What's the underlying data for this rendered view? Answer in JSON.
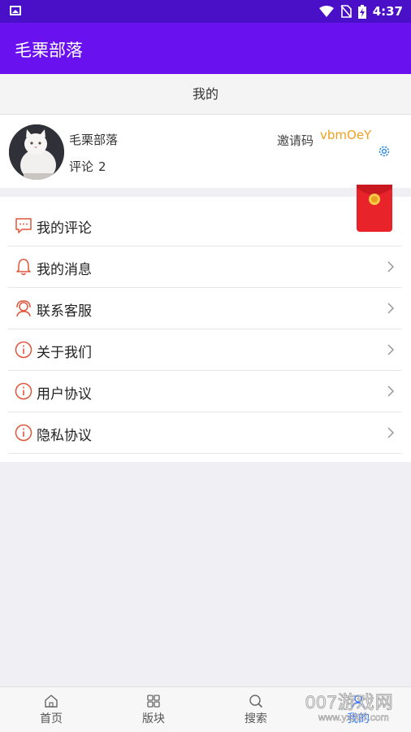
{
  "status_bar": {
    "time": "4:37"
  },
  "app_bar": {
    "title": "毛栗部落"
  },
  "page": {
    "title": "我的"
  },
  "profile": {
    "username": "毛栗部落",
    "comment_label": "评论",
    "comment_count": "2",
    "invite_label": "邀请码",
    "invite_code": "vbmOeY"
  },
  "menu": {
    "items": [
      {
        "label": "我的评论",
        "icon": "comment-icon"
      },
      {
        "label": "我的消息",
        "icon": "bell-icon"
      },
      {
        "label": "联系客服",
        "icon": "headset-icon"
      },
      {
        "label": "关于我们",
        "icon": "info-icon"
      },
      {
        "label": "用户协议",
        "icon": "info-icon"
      },
      {
        "label": "隐私协议",
        "icon": "info-icon"
      }
    ]
  },
  "tabs": [
    {
      "label": "首页",
      "icon": "home-icon"
    },
    {
      "label": "版块",
      "icon": "grid-icon"
    },
    {
      "label": "搜索",
      "icon": "search-icon"
    },
    {
      "label": "我的",
      "icon": "person-icon",
      "active": true
    }
  ],
  "watermark": {
    "main": "007游戏网",
    "url": "www.yx007.com"
  },
  "colors": {
    "status_bar": "#4a10c8",
    "app_bar": "#6a11f0",
    "menu_icon": "#e0553a",
    "active_tab": "#3a7bff",
    "invite_code": "#f0a020"
  }
}
